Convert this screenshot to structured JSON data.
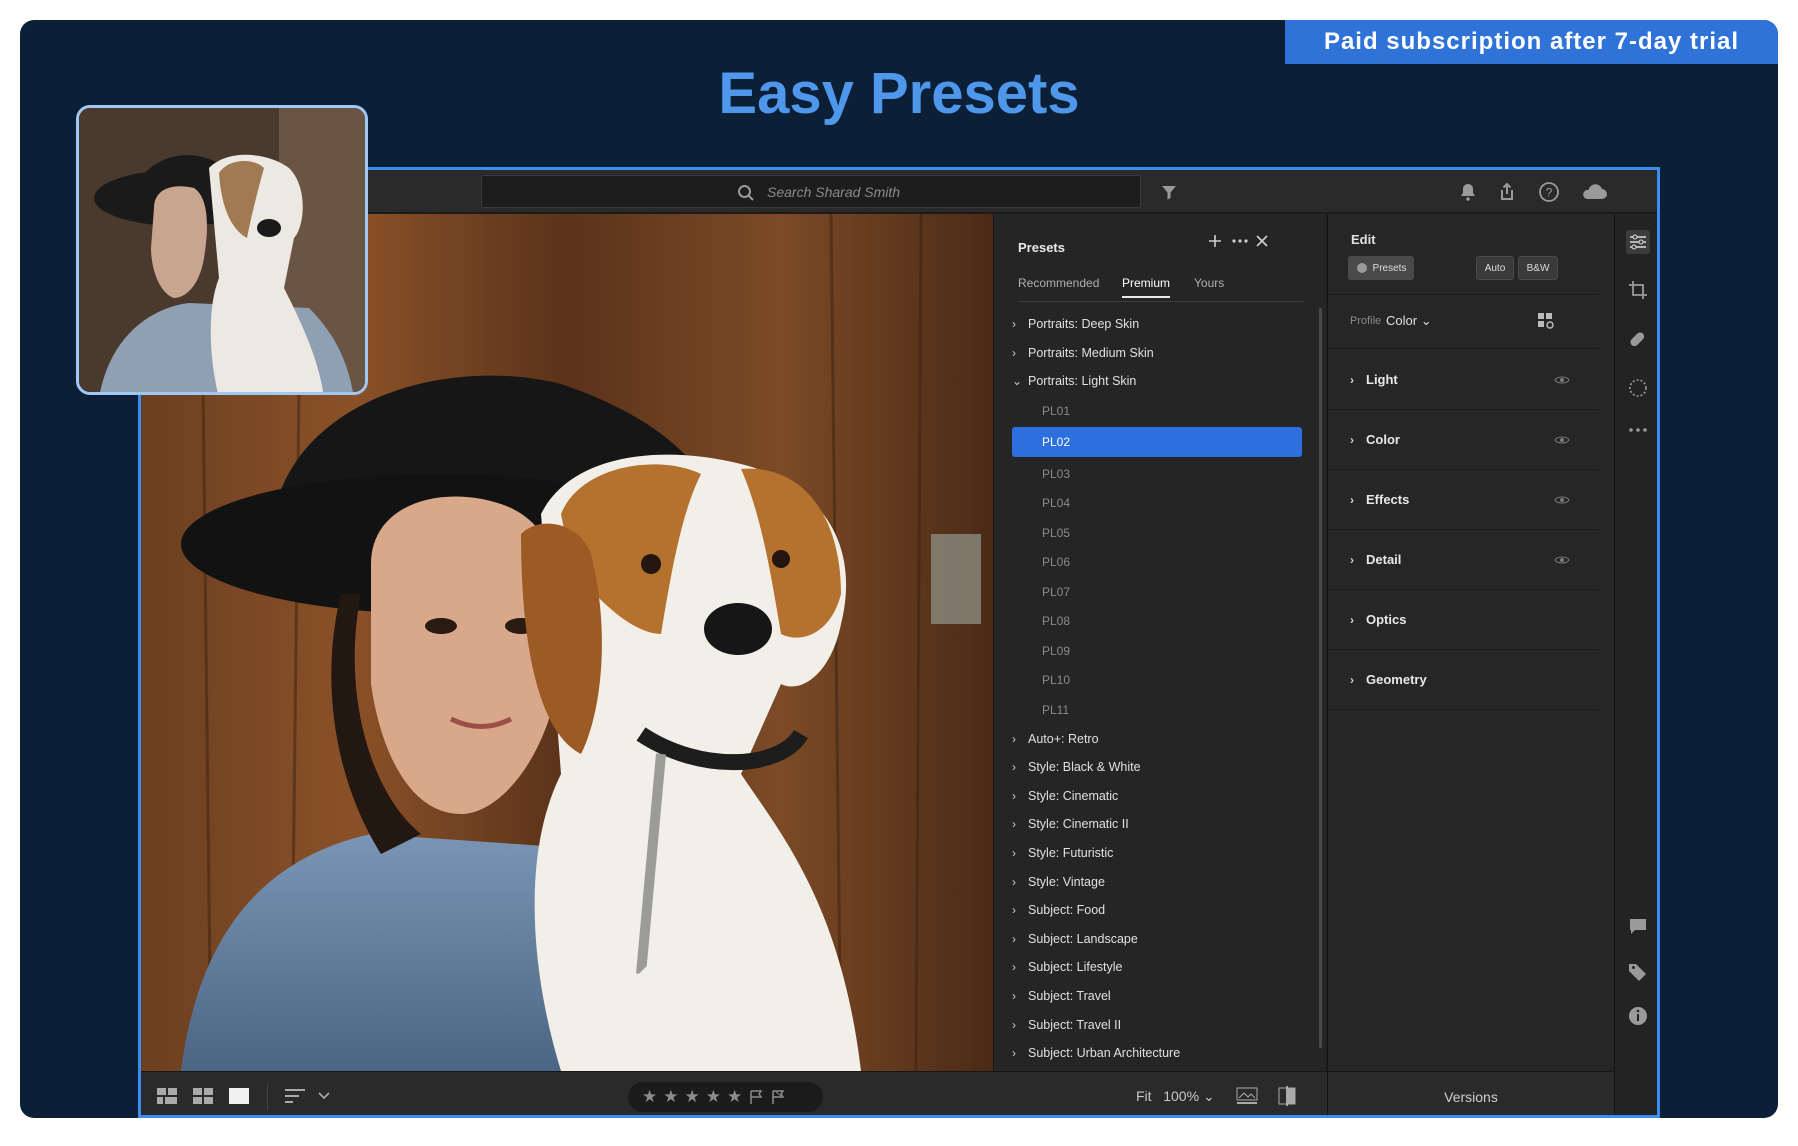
{
  "banner": {
    "text": "Paid subscription after 7-day trial"
  },
  "headline": {
    "text": "Easy Presets"
  },
  "search": {
    "placeholder": "Search Sharad Smith"
  },
  "presets_panel": {
    "title": "Presets",
    "tabs": [
      {
        "label": "Recommended",
        "active": false
      },
      {
        "label": "Premium",
        "active": true
      },
      {
        "label": "Yours",
        "active": false
      }
    ],
    "groups_before": [
      "Portraits: Deep Skin",
      "Portraits: Medium Skin"
    ],
    "expanded_group": "Portraits: Light Skin",
    "items": [
      "PL01",
      "PL02",
      "PL03",
      "PL04",
      "PL05",
      "PL06",
      "PL07",
      "PL08",
      "PL09",
      "PL10",
      "PL11"
    ],
    "selected_item": "PL02",
    "groups_after": [
      "Auto+: Retro",
      "Style: Black & White",
      "Style: Cinematic",
      "Style: Cinematic II",
      "Style: Futuristic",
      "Style: Vintage",
      "Subject: Food",
      "Subject: Landscape",
      "Subject: Lifestyle",
      "Subject: Travel",
      "Subject: Travel II",
      "Subject: Urban Architecture"
    ]
  },
  "edit_panel": {
    "title": "Edit",
    "presets_button": "Presets",
    "auto_button": "Auto",
    "bw_button": "B&W",
    "profile_label": "Profile",
    "profile_value": "Color",
    "sections": [
      "Light",
      "Color",
      "Effects",
      "Detail",
      "Optics",
      "Geometry"
    ]
  },
  "bottom_bar": {
    "fit_label": "Fit",
    "zoom_value": "100%",
    "versions_label": "Versions"
  },
  "colors": {
    "accent": "#2f73d9",
    "headline": "#4f97ea",
    "background": "#0b1f37",
    "selection": "#2e6fe0"
  }
}
